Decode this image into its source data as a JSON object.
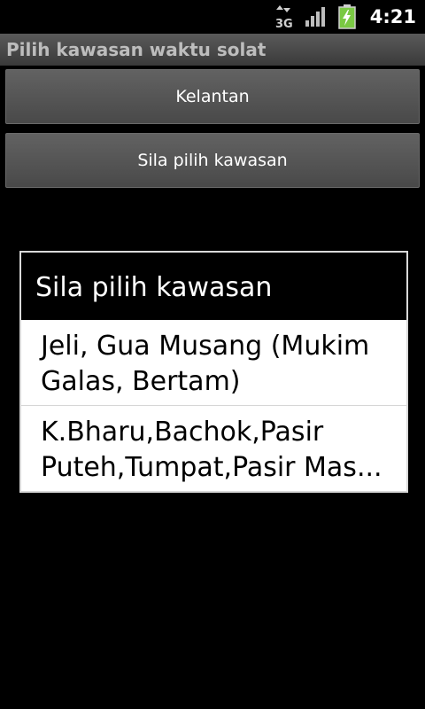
{
  "status_bar": {
    "network_label": "3G",
    "time": "4:21",
    "icons": [
      "network-3g-icon",
      "signal-bars-icon",
      "battery-charging-icon"
    ]
  },
  "app": {
    "title": "Pilih kawasan waktu solat"
  },
  "buttons": {
    "state": "Kelantan",
    "zone": "Sila pilih kawasan"
  },
  "dialog": {
    "title": "Sila pilih kawasan",
    "items": [
      {
        "line1": "Jeli, Gua Musang (Mukim",
        "line2": "Galas, Bertam)"
      },
      {
        "line1": "K.Bharu,Bachok,Pasir",
        "line2": "Puteh,Tumpat,Pasir Mas..."
      }
    ]
  },
  "colors": {
    "background": "#000000",
    "title_bar": "#4a4a4a",
    "button": "#555555",
    "dialog_body": "#ffffff",
    "battery_charge": "#7ac943"
  }
}
